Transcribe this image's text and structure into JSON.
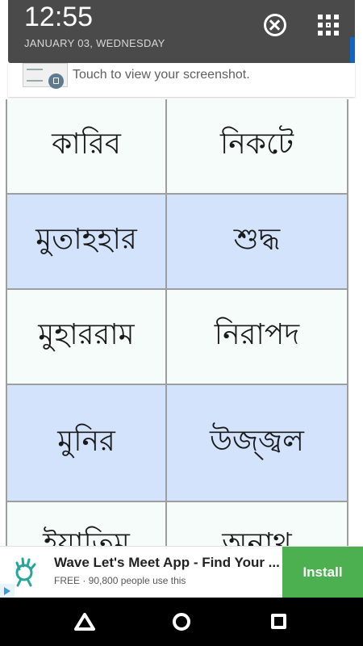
{
  "status": {
    "time": "12:55",
    "date": "JANUARY 03, WEDNESDAY"
  },
  "screenshot_notification": {
    "message": "Touch to view your screenshot."
  },
  "words": [
    {
      "left": "কারিব",
      "right": "নিকটে"
    },
    {
      "left": "মুতাহহার",
      "right": "শুদ্ধ"
    },
    {
      "left": "মুহাররাম",
      "right": "নিরাপদ"
    },
    {
      "left": "মুনির",
      "right": "উজ্জ্বল"
    },
    {
      "left": "ইয়াতিম",
      "right": "অনাথ"
    }
  ],
  "ad": {
    "title": "Wave Let's Meet App - Find Your ...",
    "subtitle": "FREE · 90,800 people use this",
    "install_label": "Install"
  },
  "colors": {
    "row_white": "#f5fcf9",
    "row_blue": "#d3e3fc",
    "install_green": "#4caf50",
    "shade": "#4a4a4a"
  }
}
